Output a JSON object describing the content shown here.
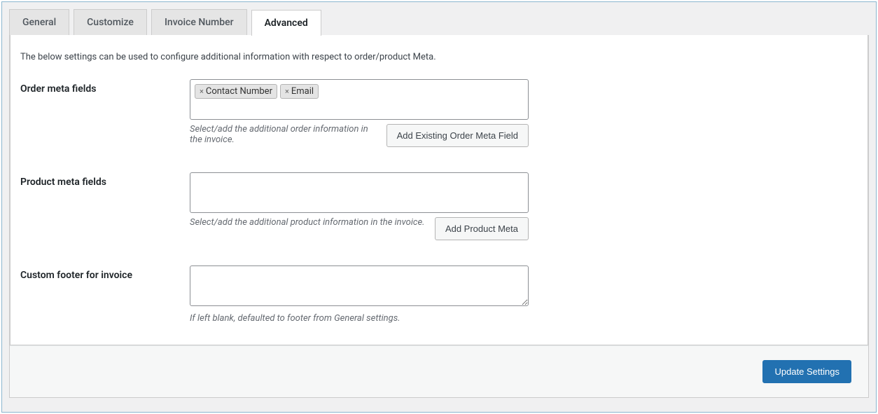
{
  "tabs": [
    {
      "label": "General"
    },
    {
      "label": "Customize"
    },
    {
      "label": "Invoice Number"
    },
    {
      "label": "Advanced"
    }
  ],
  "intro": "The below settings can be used to configure additional information with respect to order/product Meta.",
  "sections": {
    "order_meta": {
      "label": "Order meta fields",
      "tags": [
        "Contact Number",
        "Email"
      ],
      "desc": "Select/add the additional order information in the invoice.",
      "button": "Add Existing Order Meta Field"
    },
    "product_meta": {
      "label": "Product meta fields",
      "tags": [],
      "desc": "Select/add the additional product information in the invoice.",
      "button": "Add Product Meta"
    },
    "custom_footer": {
      "label": "Custom footer for invoice",
      "value": "",
      "desc": "If left blank, defaulted to footer from General settings."
    }
  },
  "footer": {
    "update_button": "Update Settings"
  }
}
